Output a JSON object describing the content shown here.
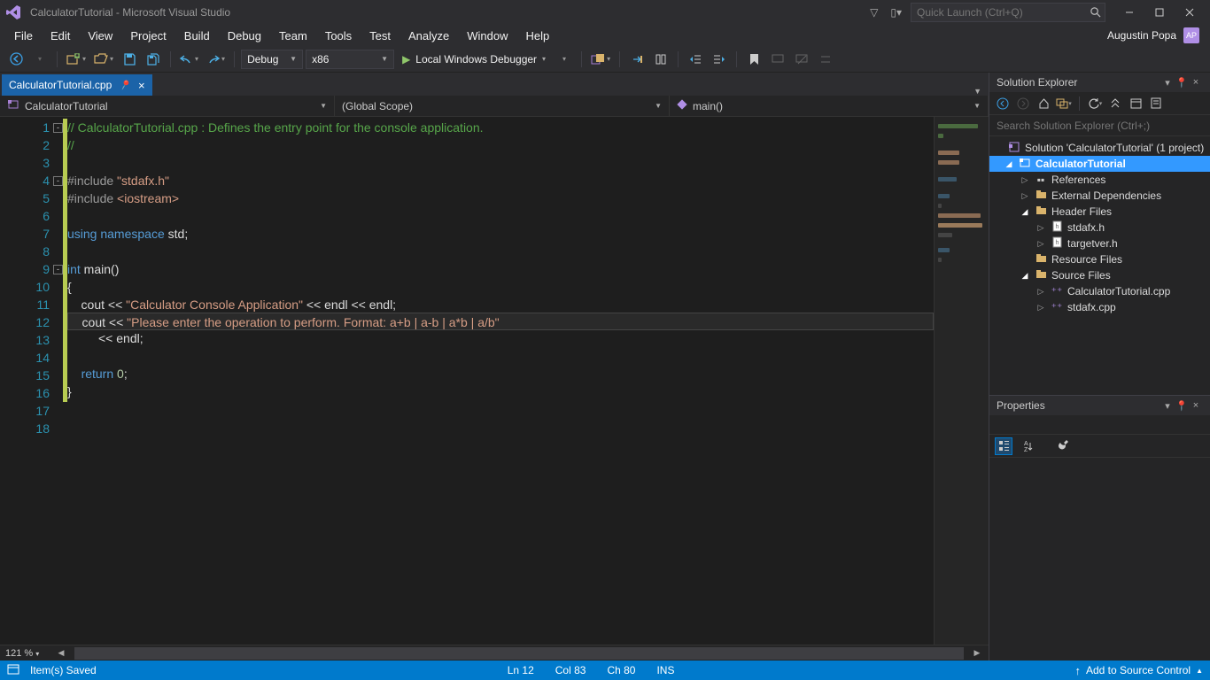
{
  "window_title": "CalculatorTutorial - Microsoft Visual Studio",
  "quick_launch_placeholder": "Quick Launch (Ctrl+Q)",
  "menu": [
    "File",
    "Edit",
    "View",
    "Project",
    "Build",
    "Debug",
    "Team",
    "Tools",
    "Test",
    "Analyze",
    "Window",
    "Help"
  ],
  "user_name": "Augustin Popa",
  "user_initials": "AP",
  "toolbar": {
    "config": "Debug",
    "platform": "x86",
    "run_label": "Local Windows Debugger"
  },
  "editor": {
    "tab_name": "CalculatorTutorial.cpp",
    "nav_project": "CalculatorTutorial",
    "nav_scope": "(Global Scope)",
    "nav_func": "main()",
    "zoom": "121 %",
    "lines": [
      {
        "n": 1,
        "fold": "-",
        "segs": [
          {
            "t": "// CalculatorTutorial.cpp : Defines the entry point for the console application.",
            "c": "c-comment"
          }
        ]
      },
      {
        "n": 2,
        "segs": [
          {
            "t": "//",
            "c": "c-comment"
          }
        ]
      },
      {
        "n": 3,
        "segs": []
      },
      {
        "n": 4,
        "fold": "-",
        "segs": [
          {
            "t": "#include ",
            "c": "c-include"
          },
          {
            "t": "\"stdafx.h\"",
            "c": "c-string"
          }
        ]
      },
      {
        "n": 5,
        "segs": [
          {
            "t": "#include ",
            "c": "c-include"
          },
          {
            "t": "<iostream>",
            "c": "c-string"
          }
        ]
      },
      {
        "n": 6,
        "segs": []
      },
      {
        "n": 7,
        "segs": [
          {
            "t": "using",
            "c": "c-keyword"
          },
          {
            "t": " "
          },
          {
            "t": "namespace",
            "c": "c-keyword"
          },
          {
            "t": " std;"
          }
        ]
      },
      {
        "n": 8,
        "segs": []
      },
      {
        "n": 9,
        "fold": "-",
        "segs": [
          {
            "t": "int",
            "c": "c-keyword"
          },
          {
            "t": " main()"
          }
        ]
      },
      {
        "n": 10,
        "segs": [
          {
            "t": "{"
          }
        ]
      },
      {
        "n": 11,
        "segs": [
          {
            "t": "    cout << "
          },
          {
            "t": "\"Calculator Console Application\"",
            "c": "c-string"
          },
          {
            "t": " << endl << endl;"
          }
        ]
      },
      {
        "n": 12,
        "current": true,
        "segs": [
          {
            "t": "    cout << "
          },
          {
            "t": "\"Please enter the operation to perform. Format: a+b | a-b | a*b | a/b\"",
            "c": "c-string"
          }
        ]
      },
      {
        "n": 13,
        "segs": [
          {
            "t": "         << endl;"
          }
        ]
      },
      {
        "n": 14,
        "segs": []
      },
      {
        "n": 15,
        "segs": [
          {
            "t": "    "
          },
          {
            "t": "return",
            "c": "c-keyword"
          },
          {
            "t": " "
          },
          {
            "t": "0",
            "c": "c-num"
          },
          {
            "t": ";"
          }
        ]
      },
      {
        "n": 16,
        "segs": [
          {
            "t": "}"
          }
        ]
      },
      {
        "n": 17,
        "segs": []
      },
      {
        "n": 18,
        "segs": []
      }
    ]
  },
  "solution_explorer": {
    "title": "Solution Explorer",
    "search_placeholder": "Search Solution Explorer (Ctrl+;)",
    "solution_label": "Solution 'CalculatorTutorial' (1 project)",
    "project": "CalculatorTutorial",
    "nodes": {
      "references": "References",
      "external_deps": "External Dependencies",
      "header_files": "Header Files",
      "stdafx_h": "stdafx.h",
      "targetver_h": "targetver.h",
      "resource_files": "Resource Files",
      "source_files": "Source Files",
      "calc_cpp": "CalculatorTutorial.cpp",
      "stdafx_cpp": "stdafx.cpp"
    }
  },
  "properties": {
    "title": "Properties"
  },
  "status": {
    "saved": "Item(s) Saved",
    "ln": "Ln 12",
    "col": "Col 83",
    "ch": "Ch 80",
    "ins": "INS",
    "add_sc": "Add to Source Control"
  }
}
